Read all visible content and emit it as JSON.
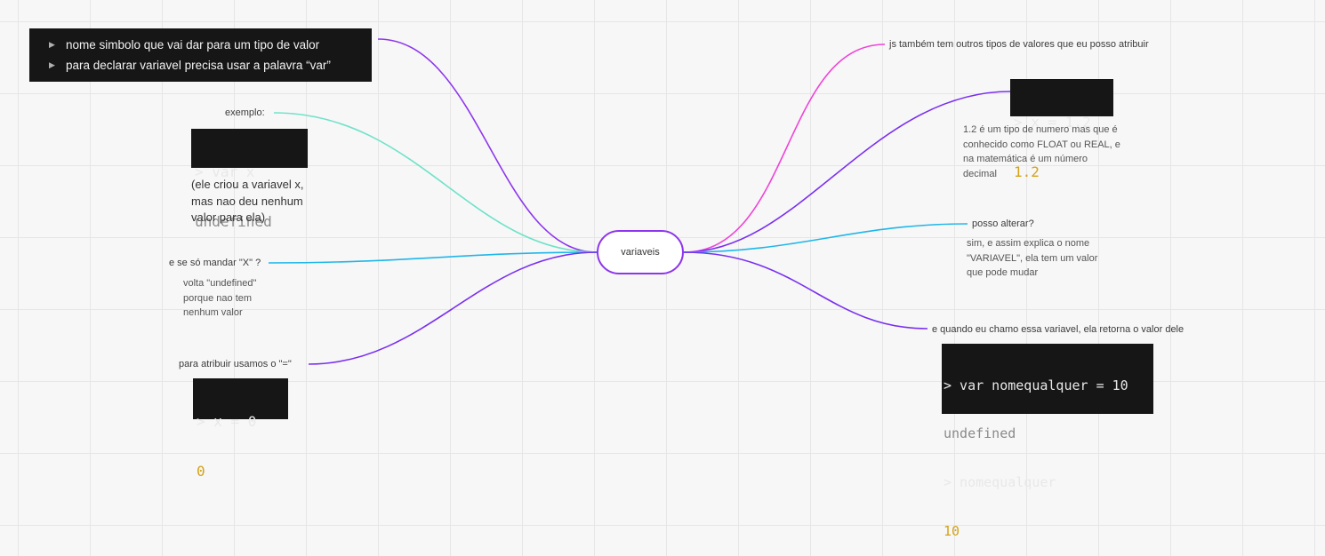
{
  "center": {
    "label": "variaveis",
    "border_color": "#8e36ec"
  },
  "branch_colors": {
    "purple": "#8e36ec",
    "violet": "#7a2ff0",
    "teal": "#6fe2c9",
    "blue": "#1fb6ea",
    "magenta": "#ee44d8"
  },
  "left": {
    "definition": {
      "bullets": [
        "nome simbolo que vai dar para um tipo de valor",
        "para declarar variavel precisa usar a palavra “var”"
      ]
    },
    "example": {
      "label": "exemplo:",
      "terminal": {
        "command": "> var x",
        "output": "undefined"
      },
      "note": [
        "(ele criou a variavel x,",
        "mas nao deu nenhum",
        "valor para ela)"
      ]
    },
    "send_x": {
      "label": "e se só mandar \"X\" ?",
      "note": [
        "volta \"undefined\"",
        "porque nao tem",
        "nenhum valor"
      ]
    },
    "assign": {
      "label": "para atribuir usamos o \"=\"",
      "terminal": {
        "command": "> x = 0",
        "output": "0"
      }
    }
  },
  "right": {
    "types": {
      "label": "js  também tem outros tipos de valores que eu posso atribuir",
      "terminal": {
        "command": "> x = 1.2",
        "output": "1.2"
      },
      "note": [
        "1.2 é um tipo de numero mas que é",
        "conhecido como FLOAT ou REAL, e",
        "na matemática é um número",
        "decimal"
      ]
    },
    "change": {
      "label": "posso alterar?",
      "note": [
        "sim, e assim explica o nome",
        "\"VARIAVEL\", ela tem um valor",
        "que pode mudar"
      ]
    },
    "call": {
      "label": "e quando eu chamo essa variavel, ela retorna o valor dele",
      "terminal": {
        "line1": "> var nomequalquer = 10",
        "line2": "undefined",
        "line3": "> nomequalquer",
        "line4": "10"
      }
    }
  }
}
